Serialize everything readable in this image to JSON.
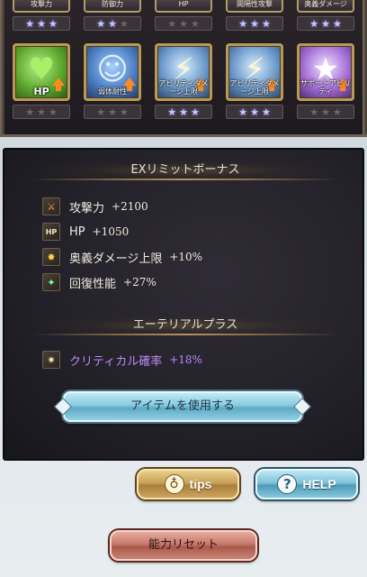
{
  "top_row": [
    {
      "label": "攻撃力",
      "stars": 3,
      "filled": 3
    },
    {
      "label": "防御力",
      "stars": 3,
      "filled": 2
    },
    {
      "label": "HP",
      "stars": 3,
      "filled": 0
    },
    {
      "label": "間隔性攻撃",
      "stars": 3,
      "filled": 3
    },
    {
      "label": "奥義ダメージ",
      "stars": 3,
      "filled": 3
    }
  ],
  "skills": [
    {
      "label": "HP",
      "icon": "heart-icon",
      "color": "#7dbf3a",
      "stars": 3,
      "filled": 0
    },
    {
      "label": "弱体耐性",
      "icon": "resist-icon",
      "color": "#4a7fc8",
      "stars": 3,
      "filled": 0
    },
    {
      "label": "アビリティダメージ上限",
      "icon": "blades-icon",
      "color": "#5f8fc0",
      "stars": 3,
      "filled": 3
    },
    {
      "label": "アビリティダメージ上限",
      "icon": "blades-icon",
      "color": "#5f8fc0",
      "stars": 3,
      "filled": 3
    },
    {
      "label": "サポートアビリティ",
      "icon": "star-icon",
      "color": "#a46fd6",
      "stars": 3,
      "filled": 0
    }
  ],
  "ex_section": {
    "title": "EXリミットボーナス",
    "stats": [
      {
        "icon": "sword-icon",
        "icon_text": "⚔",
        "name": "攻撃力",
        "value": "+2100"
      },
      {
        "icon": "hp-icon",
        "icon_text": "HP",
        "name": "HP",
        "value": "+1050"
      },
      {
        "icon": "ougi-icon",
        "icon_text": "✸",
        "name": "奥義ダメージ上限",
        "value": "+10%"
      },
      {
        "icon": "heal-icon",
        "icon_text": "✦",
        "name": "回復性能",
        "value": "+27%"
      }
    ]
  },
  "ether_section": {
    "title": "エーテリアルプラス",
    "stats": [
      {
        "icon": "critical-icon",
        "icon_text": "✷",
        "name": "クリティカル確率",
        "value": "+18%"
      }
    ]
  },
  "buttons": {
    "use_item": "アイテムを使用する",
    "tips": "tips",
    "help": "HELP",
    "reset": "能力リセット"
  },
  "colors": {
    "star_on": "#c8c4ff",
    "ether_text": "#b98cf5",
    "frame_gold": "#b79a5b"
  }
}
